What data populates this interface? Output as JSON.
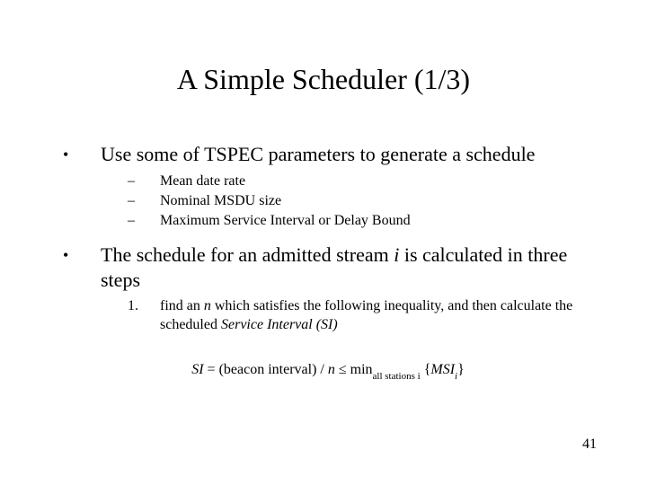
{
  "title": "A Simple Scheduler (1/3)",
  "bullets": [
    {
      "text": "Use some of TSPEC parameters to generate a schedule",
      "sub": [
        "Mean date rate",
        "Nominal MSDU size",
        "Maximum Service Interval or Delay Bound"
      ]
    },
    {
      "text_parts": {
        "pre": "The schedule for an admitted stream ",
        "i": "i",
        "post": " is calculated in three steps"
      },
      "numbered": [
        {
          "n": "1.",
          "pre": "find an ",
          "n_it": "n",
          "mid": " which satisfies the following inequality, and then calculate the scheduled ",
          "si_it": "Service Interval (SI)"
        }
      ]
    }
  ],
  "formula": {
    "lhs_si": "SI",
    "eq": " = (beacon interval) / ",
    "n": "n",
    "le": " ≤ min",
    "sub": "all stations i",
    "brace_open": " {",
    "msi": "MSI",
    "msi_sub": "i",
    "brace_close": "}"
  },
  "page_number": "41"
}
